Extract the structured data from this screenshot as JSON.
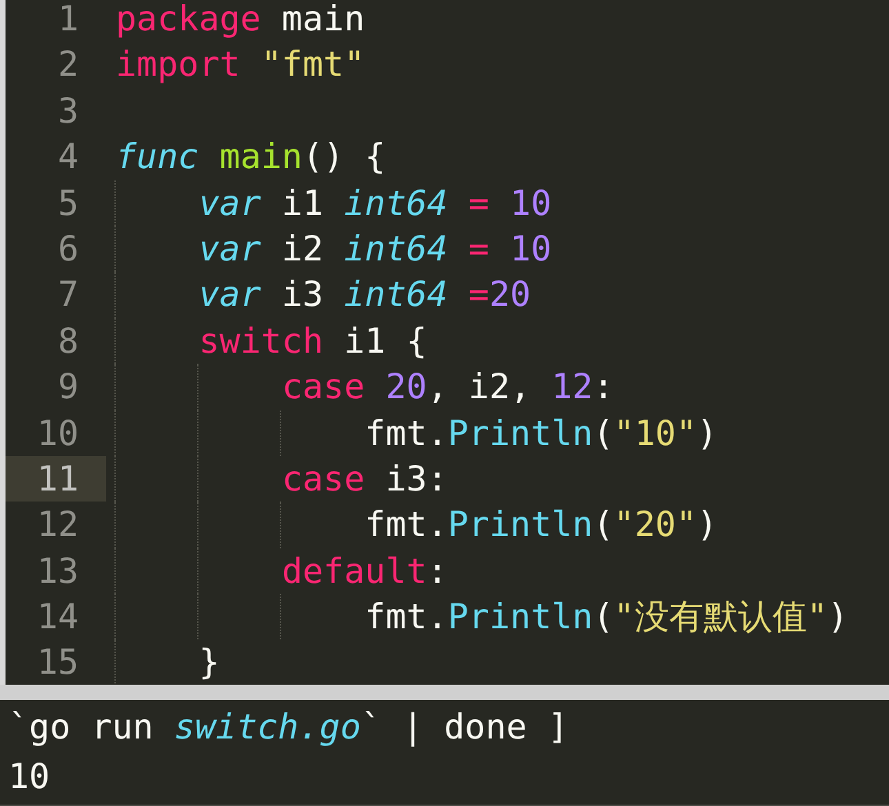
{
  "editor": {
    "lines": [
      {
        "number": "1",
        "current": false,
        "tokens": [
          {
            "t": "package",
            "kind": "keyword"
          },
          {
            "t": " main",
            "kind": "plain"
          }
        ]
      },
      {
        "number": "2",
        "current": false,
        "tokens": [
          {
            "t": "import",
            "kind": "keyword"
          },
          {
            "t": " \"fmt\"",
            "kind": "string"
          }
        ]
      },
      {
        "number": "3",
        "current": false
      },
      {
        "number": "4",
        "current": false,
        "tokens": [
          {
            "t": "func",
            "kind": "storage"
          },
          {
            "t": " main",
            "kind": "entity"
          },
          {
            "t": "() {",
            "kind": "plain"
          }
        ]
      },
      {
        "number": "5",
        "current": false,
        "tokens": [
          {
            "t": "    var",
            "kind": "storage"
          },
          {
            "t": " i1 ",
            "kind": "plain"
          },
          {
            "t": "int64",
            "kind": "storage"
          },
          {
            "t": " =",
            "kind": "keyword"
          },
          {
            "t": " 10",
            "kind": "number"
          }
        ]
      },
      {
        "number": "6",
        "current": false,
        "tokens": [
          {
            "t": "    var",
            "kind": "storage"
          },
          {
            "t": " i2 ",
            "kind": "plain"
          },
          {
            "t": "int64",
            "kind": "storage"
          },
          {
            "t": " =",
            "kind": "keyword"
          },
          {
            "t": " 10",
            "kind": "number"
          }
        ]
      },
      {
        "number": "7",
        "current": false,
        "tokens": [
          {
            "t": "    var",
            "kind": "storage"
          },
          {
            "t": " i3 ",
            "kind": "plain"
          },
          {
            "t": "int64",
            "kind": "storage"
          },
          {
            "t": " =",
            "kind": "keyword"
          },
          {
            "t": "20",
            "kind": "number"
          }
        ]
      },
      {
        "number": "8",
        "current": false,
        "tokens": [
          {
            "t": "    switch",
            "kind": "keyword"
          },
          {
            "t": " i1 {",
            "kind": "plain"
          }
        ]
      },
      {
        "number": "9",
        "current": false,
        "tokens": [
          {
            "t": "        case",
            "kind": "keyword"
          },
          {
            "t": " 20",
            "kind": "number"
          },
          {
            "t": ", i2, ",
            "kind": "plain"
          },
          {
            "t": "12",
            "kind": "number"
          },
          {
            "t": ":",
            "kind": "plain"
          }
        ]
      },
      {
        "number": "10",
        "current": false,
        "tokens": [
          {
            "t": "            fmt.",
            "kind": "plain"
          },
          {
            "t": "Println",
            "kind": "support"
          },
          {
            "t": "(",
            "kind": "plain"
          },
          {
            "t": "\"10\"",
            "kind": "string"
          },
          {
            "t": ")",
            "kind": "plain"
          }
        ]
      },
      {
        "number": "11",
        "current": true,
        "tokens": [
          {
            "t": "        case",
            "kind": "keyword"
          },
          {
            "t": " i3:",
            "kind": "plain"
          }
        ]
      },
      {
        "number": "12",
        "current": false,
        "tokens": [
          {
            "t": "            fmt.",
            "kind": "plain"
          },
          {
            "t": "Println",
            "kind": "support"
          },
          {
            "t": "(",
            "kind": "plain"
          },
          {
            "t": "\"20\"",
            "kind": "string"
          },
          {
            "t": ")",
            "kind": "plain"
          }
        ]
      },
      {
        "number": "13",
        "current": false,
        "tokens": [
          {
            "t": "        default",
            "kind": "keyword"
          },
          {
            "t": ":",
            "kind": "plain"
          }
        ]
      },
      {
        "number": "14",
        "current": false,
        "tokens": [
          {
            "t": "            fmt.",
            "kind": "plain"
          },
          {
            "t": "Println",
            "kind": "support"
          },
          {
            "t": "(",
            "kind": "plain"
          },
          {
            "t": "\"没有默认值\"",
            "kind": "string"
          },
          {
            "t": ")",
            "kind": "plain"
          }
        ]
      },
      {
        "number": "15",
        "current": false,
        "tokens": [
          {
            "t": "    }",
            "kind": "plain"
          }
        ]
      }
    ]
  },
  "output": {
    "lines": [
      {
        "tokens": [
          {
            "t": "`go run ",
            "kind": "plain"
          },
          {
            "t": "switch.go",
            "kind": "storage"
          },
          {
            "t": "` | done ]",
            "kind": "plain"
          }
        ]
      },
      {
        "tokens": [
          {
            "t": "10",
            "kind": "plain"
          }
        ]
      }
    ]
  }
}
